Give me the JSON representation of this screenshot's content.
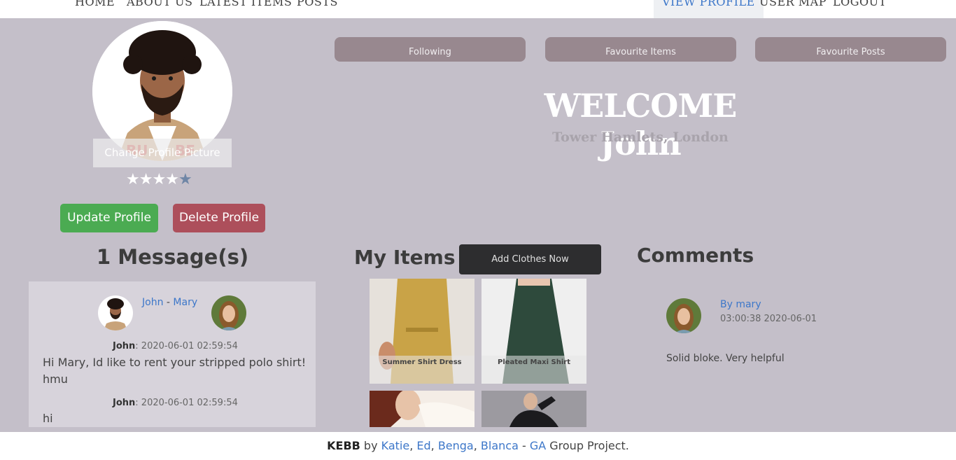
{
  "nav": {
    "home": "HOME",
    "about": "ABOUT US",
    "latest": "LATEST ITEMS",
    "posts": "POSTS",
    "view_profile": "VIEW PROFILE",
    "user_map": "USER MAP",
    "logout": "LOGOUT"
  },
  "profile": {
    "change_pic": "Change Profile Picture",
    "rating_filled": 4,
    "rating_total": 5,
    "update": "Update Profile",
    "delete": "Delete Profile",
    "welcome": "WELCOME John",
    "location": "Tower Hamlets, London"
  },
  "tabs": {
    "following": "Following",
    "fav_items": "Favourite Items",
    "fav_posts": "Favourite Posts"
  },
  "messages": {
    "title": "1 Message(s)",
    "from": "John",
    "sep": " - ",
    "to": "Mary",
    "entries": [
      {
        "author": "John",
        "time": ": 2020-06-01 02:59:54",
        "text": "Hi Mary, Id like to rent your stripped polo shirt! hmu"
      },
      {
        "author": "John",
        "time": ": 2020-06-01 02:59:54",
        "text": "hi"
      }
    ]
  },
  "items": {
    "title": "My Items",
    "add": "Add Clothes Now",
    "list": [
      "Summer Shirt Dress",
      "Pleated Maxi Shirt",
      "",
      ""
    ]
  },
  "comments": {
    "title": "Comments",
    "author": "By mary",
    "time": "03:00:38 2020-06-01",
    "text": "Solid bloke. Very helpful"
  },
  "footer": {
    "brand": "KEBB",
    "by": " by ",
    "n1": "Katie",
    "n2": "Ed",
    "n3": "Benga",
    "n4": "Blanca",
    "dash": " - ",
    "ga": "GA",
    "rest": " Group Project."
  },
  "colors": {
    "background": "#c4bfc9",
    "link": "#3d77c9",
    "update": "#4bab52",
    "delete": "#ad4f5b"
  }
}
